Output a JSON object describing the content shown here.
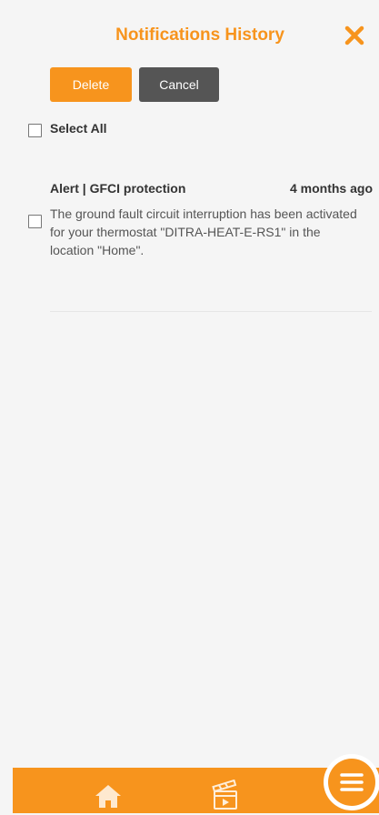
{
  "header": {
    "title": "Notifications History"
  },
  "actions": {
    "delete_label": "Delete",
    "cancel_label": "Cancel"
  },
  "select_all": {
    "label": "Select All",
    "checked": false
  },
  "notifications": [
    {
      "title": "Alert | GFCI protection",
      "time": "4 months ago",
      "body": "The ground fault circuit interruption has been activated for your thermostat \"DITRA-HEAT-E-RS1\" in the location \"Home\".",
      "checked": false
    }
  ],
  "bottom_nav": {
    "items": [
      {
        "icon": "home-icon"
      },
      {
        "icon": "scenes-icon"
      }
    ],
    "menu_icon": "menu-icon"
  },
  "colors": {
    "accent": "#f7941d",
    "secondary_button": "#555555",
    "background": "#f5f5f5"
  }
}
